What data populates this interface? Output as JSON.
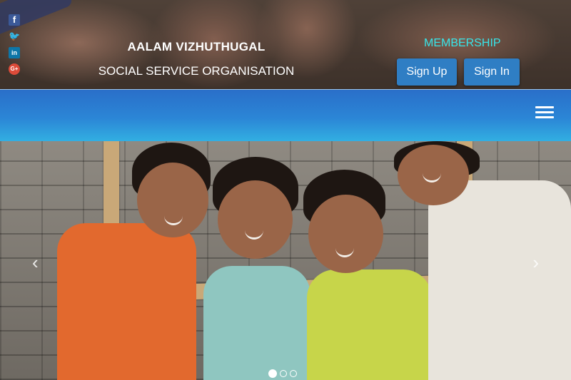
{
  "header": {
    "social": [
      {
        "icon": "facebook-icon",
        "glyph": "f"
      },
      {
        "icon": "twitter-icon",
        "glyph": "🐦"
      },
      {
        "icon": "linkedin-icon",
        "glyph": "in"
      },
      {
        "icon": "google-plus-icon",
        "glyph": "G+"
      }
    ],
    "org_name": "AALAM VIZHUTHUGAL",
    "org_subtitle": "SOCIAL SERVICE ORGANISATION",
    "membership_label": "MEMBERSHIP",
    "signup_label": "Sign Up",
    "signin_label": "Sign In"
  },
  "nav": {
    "menu_icon": "hamburger-menu-icon"
  },
  "carousel": {
    "prev_glyph": "‹",
    "next_glyph": "›",
    "slide_count": 3,
    "active_slide": 1
  },
  "colors": {
    "accent_cyan": "#37e6ea",
    "button_blue": "#2f7ec4",
    "nav_gradient_top": "#2a6fc9",
    "nav_gradient_bottom": "#32b0e2"
  }
}
